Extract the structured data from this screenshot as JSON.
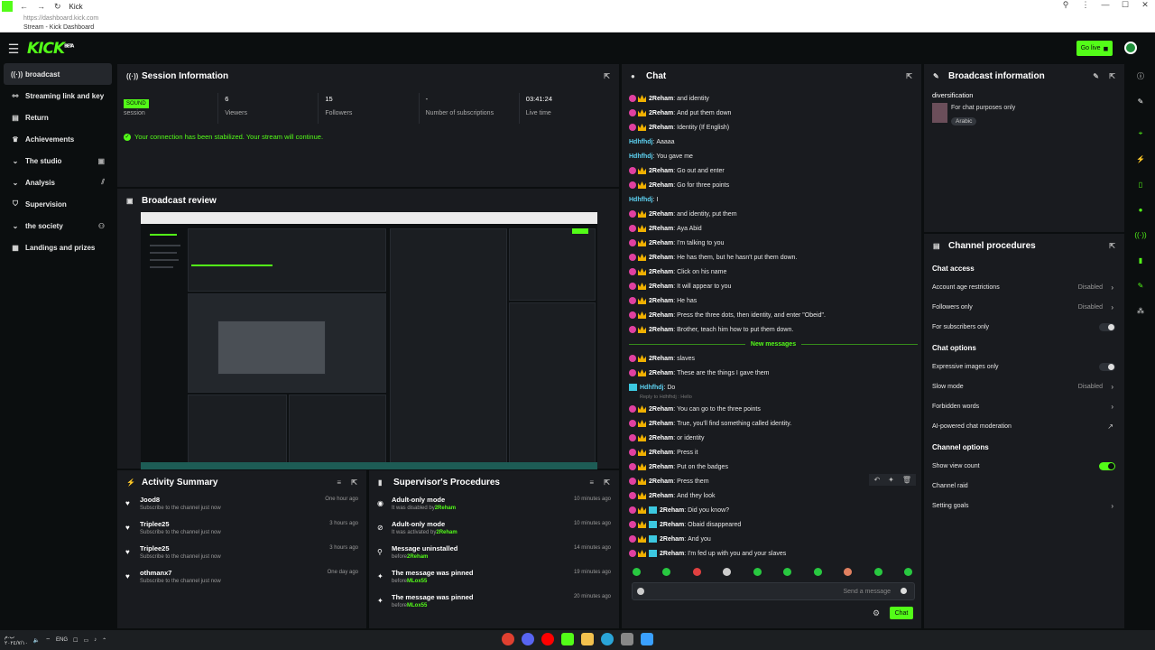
{
  "browser": {
    "tab_title": "Kick",
    "url": "https://dashboard.kick.com",
    "page_title": "Stream - Kick Dashboard",
    "back_icon": "arrow-left-icon",
    "forward_icon": "arrow-right-icon",
    "reload_icon": "reload-icon"
  },
  "header": {
    "logo": "KICK",
    "logo_badge": "BETA",
    "go_live_label": "Go live"
  },
  "sidebar": {
    "items": [
      {
        "label": "broadcast",
        "icon": "broadcast-icon"
      },
      {
        "label": "Streaming link and key",
        "icon": "link-icon"
      },
      {
        "label": "Return",
        "icon": "return-icon"
      },
      {
        "label": "Achievements",
        "icon": "trophy-icon"
      },
      {
        "label": "The studio",
        "icon": "chevron-down-icon"
      },
      {
        "label": "Analysis",
        "icon": "chevron-down-icon"
      },
      {
        "label": "Supervision",
        "icon": "shield-icon"
      },
      {
        "label": "the society",
        "icon": "chevron-down-icon"
      },
      {
        "label": "Landings and prizes",
        "icon": "grid-icon"
      }
    ]
  },
  "session": {
    "title": "Session Information",
    "badge": "SOUND",
    "stats": [
      {
        "value": "",
        "label": "session"
      },
      {
        "value": "6",
        "label": "Viewers"
      },
      {
        "value": "15",
        "label": "Followers"
      },
      {
        "value": "-",
        "label": "Number of subscriptions"
      },
      {
        "value": "03:41:24",
        "label": "Live time"
      }
    ],
    "connection_message": "Your connection has been stabilized. Your stream will continue."
  },
  "broadcast_review": {
    "title": "Broadcast review"
  },
  "activity": {
    "title": "Activity Summary",
    "items": [
      {
        "name": "Jood8",
        "desc": "Subscribe to the channel just now",
        "time": "One hour ago"
      },
      {
        "name": "Triplee25",
        "desc": "Subscribe to the channel just now",
        "time": "3 hours ago"
      },
      {
        "name": "Triplee25",
        "desc": "Subscribe to the channel just now",
        "time": "3 hours ago"
      },
      {
        "name": "othmanx7",
        "desc": "Subscribe to the channel just now",
        "time": "One day ago"
      }
    ]
  },
  "supervisor": {
    "title": "Supervisor's Procedures",
    "items": [
      {
        "title": "Adult-only mode",
        "desc": "It was disabled by",
        "user": "2Reham",
        "time": "10 minutes ago"
      },
      {
        "title": "Adult-only mode",
        "desc": "It was activated by",
        "user": "2Reham",
        "time": "10 minutes ago"
      },
      {
        "title": "Message uninstalled",
        "desc": "before",
        "user": "2Reham",
        "time": "14 minutes ago"
      },
      {
        "title": "The message was pinned",
        "desc": "before",
        "user": "MLox55",
        "time": "19 minutes ago"
      },
      {
        "title": "The message was pinned",
        "desc": "before",
        "user": "MLox55",
        "time": "20 minutes ago"
      }
    ]
  },
  "chat": {
    "title": "Chat",
    "new_messages_label": "New messages",
    "reply_to": "Reply to Hdhfhdj : Hello",
    "messages_before": [
      {
        "user": "2Reham",
        "text": "and identity",
        "badges": "two"
      },
      {
        "user": "2Reham",
        "text": "And put them down",
        "badges": "two"
      },
      {
        "user": "2Reham",
        "text": "Identity (If English)",
        "badges": "two"
      },
      {
        "user": "Hdhfhdj",
        "text": "Aaaaa",
        "badges": "none"
      },
      {
        "user": "Hdhfhdj",
        "text": "You gave me",
        "badges": "none"
      },
      {
        "user": "2Reham",
        "text": "Go out and enter",
        "badges": "two"
      },
      {
        "user": "2Reham",
        "text": "Go for three points",
        "badges": "two"
      },
      {
        "user": "Hdhfhdj",
        "text": "I",
        "badges": "none"
      },
      {
        "user": "2Reham",
        "text": "and identity, put them",
        "badges": "two"
      },
      {
        "user": "2Reham",
        "text": "Aya Abid",
        "badges": "two"
      },
      {
        "user": "2Reham",
        "text": "I'm talking to you",
        "badges": "two"
      },
      {
        "user": "2Reham",
        "text": "He has them, but he hasn't put them down.",
        "badges": "two"
      },
      {
        "user": "2Reham",
        "text": "Click on his name",
        "badges": "two"
      },
      {
        "user": "2Reham",
        "text": "It will appear to you",
        "badges": "two"
      },
      {
        "user": "2Reham",
        "text": "He has",
        "badges": "two"
      },
      {
        "user": "2Reham",
        "text": "Press the three dots, then identity, and enter \"Obeid\".",
        "badges": "two"
      },
      {
        "user": "2Reham",
        "text": "Brother, teach him how to put them down.",
        "badges": "two"
      }
    ],
    "messages_after": [
      {
        "user": "2Reham",
        "text": "slaves",
        "badges": "two"
      },
      {
        "user": "2Reham",
        "text": "These are the things I gave them",
        "badges": "two"
      },
      {
        "user": "Hdhfhdj",
        "text": "Do",
        "badges": "one"
      },
      {
        "user": "2Reham",
        "text": "You can go to the three points",
        "badges": "two"
      },
      {
        "user": "2Reham",
        "text": "True, you'll find something called identity.",
        "badges": "two"
      },
      {
        "user": "2Reham",
        "text": "or identity",
        "badges": "two"
      },
      {
        "user": "2Reham",
        "text": "Press it",
        "badges": "two"
      },
      {
        "user": "2Reham",
        "text": "Put on the badges",
        "badges": "two"
      },
      {
        "user": "2Reham",
        "text": "Press them",
        "badges": "two"
      },
      {
        "user": "2Reham",
        "text": "And they look",
        "badges": "two"
      },
      {
        "user": "2Reham",
        "text": "Did you know?",
        "badges": "three"
      },
      {
        "user": "2Reham",
        "text": "Obaid disappeared",
        "badges": "three"
      },
      {
        "user": "2Reham",
        "text": "And you",
        "badges": "three"
      },
      {
        "user": "2Reham",
        "text": "I'm fed up with you and your slaves",
        "badges": "three"
      }
    ],
    "input_placeholder": "Send a message",
    "send_label": "Chat"
  },
  "broadcast_info": {
    "title": "Broadcast information",
    "stream_title": "diversification",
    "note": "For chat purposes only",
    "tag": "Arabic"
  },
  "channel_procedures": {
    "title": "Channel procedures",
    "sections": {
      "chat_access": "Chat access",
      "chat_options": "Chat options",
      "channel_options": "Channel options"
    },
    "chat_access": [
      {
        "label": "Account age restrictions",
        "status": "Disabled"
      },
      {
        "label": "Followers only",
        "status": "Disabled"
      },
      {
        "label": "For subscribers only",
        "status": ""
      }
    ],
    "chat_options": [
      {
        "label": "Expressive images only",
        "status": ""
      },
      {
        "label": "Slow mode",
        "status": "Disabled"
      },
      {
        "label": "Forbidden words",
        "status": ""
      },
      {
        "label": "AI-powered chat moderation",
        "status": ""
      }
    ],
    "channel_options": [
      {
        "label": "Show view count",
        "status": ""
      },
      {
        "label": "Channel raid",
        "status": ""
      },
      {
        "label": "Setting goals",
        "status": ""
      }
    ]
  },
  "taskbar": {
    "lang": "ENG",
    "time": "ب.م",
    "date": "٢٠٢٤/٧/١٠"
  },
  "colors": {
    "accent": "#53fc18",
    "bg": "#0b0e0f",
    "panel": "#191b1f"
  }
}
